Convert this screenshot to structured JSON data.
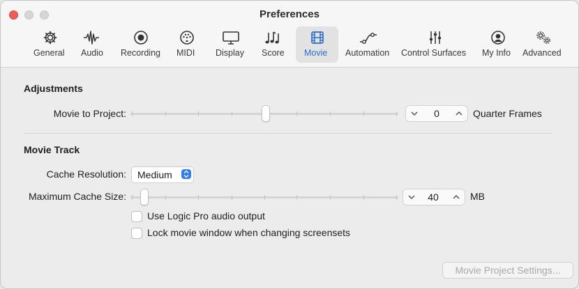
{
  "window": {
    "title": "Preferences"
  },
  "toolbar": {
    "items": [
      {
        "label": "General",
        "icon": "gear-icon"
      },
      {
        "label": "Audio",
        "icon": "waveform-icon"
      },
      {
        "label": "Recording",
        "icon": "record-icon"
      },
      {
        "label": "MIDI",
        "icon": "midi-port-icon"
      },
      {
        "label": "Display",
        "icon": "display-icon"
      },
      {
        "label": "Score",
        "icon": "music-notes-icon"
      },
      {
        "label": "Movie",
        "icon": "film-icon",
        "selected": true
      },
      {
        "label": "Automation",
        "icon": "automation-curve-icon"
      },
      {
        "label": "Control Surfaces",
        "icon": "sliders-icon"
      },
      {
        "label": "My Info",
        "icon": "person-icon"
      },
      {
        "label": "Advanced",
        "icon": "gears-icon"
      }
    ]
  },
  "adjustments": {
    "heading": "Adjustments",
    "movie_to_project_label": "Movie to Project:",
    "movie_to_project_value": "0",
    "movie_to_project_unit": "Quarter Frames",
    "movie_to_project_slider_position": 0.5
  },
  "movie_track": {
    "heading": "Movie Track",
    "cache_resolution_label": "Cache Resolution:",
    "cache_resolution_value": "Medium",
    "max_cache_label": "Maximum Cache Size:",
    "max_cache_value": "40",
    "max_cache_unit": "MB",
    "max_cache_slider_position": 0.02,
    "use_logic_audio_label": "Use Logic Pro audio output",
    "use_logic_audio_checked": false,
    "lock_movie_window_label": "Lock movie window when changing screensets",
    "lock_movie_window_checked": false
  },
  "footer": {
    "movie_project_settings_label": "Movie Project Settings..."
  },
  "colors": {
    "accent": "#2f7bf5",
    "close": "#ee5f57"
  }
}
